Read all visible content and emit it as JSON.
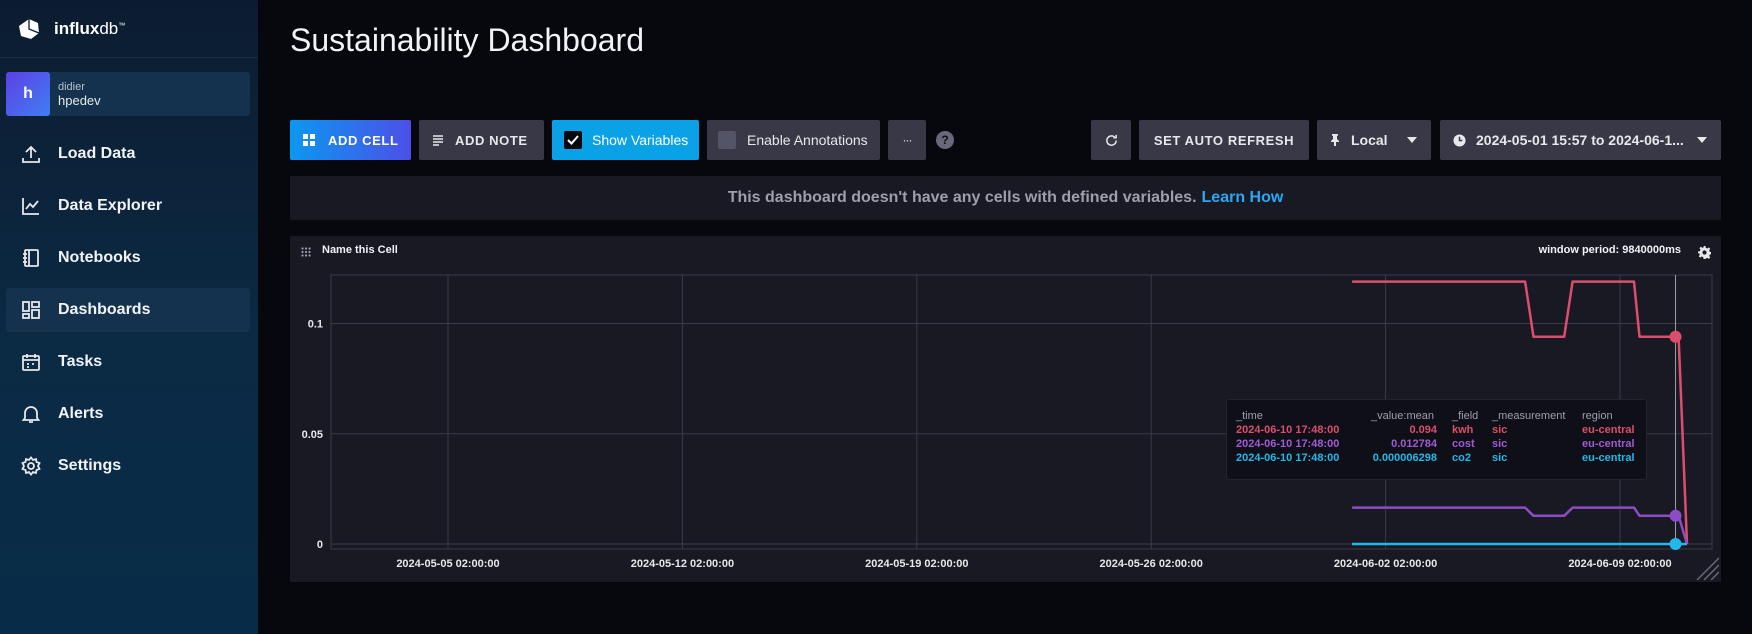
{
  "brand": {
    "name_bold": "influx",
    "name_light": "db"
  },
  "org": {
    "avatar_letter": "h",
    "user": "didier",
    "name": "hpedev"
  },
  "nav": [
    {
      "label": "Load Data",
      "icon": "upload-icon",
      "active": false
    },
    {
      "label": "Data Explorer",
      "icon": "graph-icon",
      "active": false
    },
    {
      "label": "Notebooks",
      "icon": "notebook-icon",
      "active": false
    },
    {
      "label": "Dashboards",
      "icon": "dashboard-icon",
      "active": true
    },
    {
      "label": "Tasks",
      "icon": "calendar-icon",
      "active": false
    },
    {
      "label": "Alerts",
      "icon": "bell-icon",
      "active": false
    },
    {
      "label": "Settings",
      "icon": "gear-icon",
      "active": false
    }
  ],
  "page": {
    "title": "Sustainability Dashboard"
  },
  "toolbar": {
    "add_cell": "ADD CELL",
    "add_note": "ADD NOTE",
    "show_variables": "Show Variables",
    "show_variables_checked": true,
    "enable_annotations": "Enable Annotations",
    "enable_annotations_checked": false,
    "more": "···",
    "help": "?",
    "set_auto_refresh": "SET AUTO REFRESH",
    "timezone": "Local",
    "time_range": "2024-05-01 15:57 to 2024-06-1..."
  },
  "banner": {
    "text": "This dashboard doesn't have any cells with defined variables.",
    "link": "Learn How"
  },
  "cell": {
    "name": "Name this Cell",
    "window_period": "window period: 9840000ms"
  },
  "colors": {
    "kwh": "#dc4e6d",
    "cost": "#8d4cc3",
    "co2": "#22b8ea",
    "accent": "#0b98ef"
  },
  "chart_data": {
    "type": "line",
    "y_ticks": [
      "0.1",
      "0.05",
      "0"
    ],
    "ylim": [
      0,
      0.12
    ],
    "x_ticks": [
      "2024-05-05 02:00:00",
      "2024-05-12 02:00:00",
      "2024-05-19 02:00:00",
      "2024-05-26 02:00:00",
      "2024-06-02 02:00:00",
      "2024-06-09 02:00:00"
    ],
    "grid": true,
    "series": [
      {
        "name": "kwh",
        "color": "#dc4e6d",
        "points": [
          [
            "2024-06-01 02:00",
            0.119
          ],
          [
            "2024-06-06 06:00",
            0.119
          ],
          [
            "2024-06-06 12:00",
            0.094
          ],
          [
            "2024-06-07 10:00",
            0.094
          ],
          [
            "2024-06-07 16:00",
            0.119
          ],
          [
            "2024-06-09 12:00",
            0.119
          ],
          [
            "2024-06-09 16:00",
            0.094
          ],
          [
            "2024-06-10 20:00",
            0.094
          ],
          [
            "2024-06-11 02:00",
            0.0
          ]
        ]
      },
      {
        "name": "cost",
        "color": "#8d4cc3",
        "points": [
          [
            "2024-06-01 02:00",
            0.0165
          ],
          [
            "2024-06-06 06:00",
            0.0165
          ],
          [
            "2024-06-06 12:00",
            0.0128
          ],
          [
            "2024-06-07 10:00",
            0.0128
          ],
          [
            "2024-06-07 16:00",
            0.0165
          ],
          [
            "2024-06-09 12:00",
            0.0165
          ],
          [
            "2024-06-09 16:00",
            0.0128
          ],
          [
            "2024-06-10 20:00",
            0.0128
          ],
          [
            "2024-06-11 02:00",
            0.0
          ]
        ]
      },
      {
        "name": "co2",
        "color": "#22b8ea",
        "points": [
          [
            "2024-06-01 02:00",
            6.298e-06
          ],
          [
            "2024-06-11 02:00",
            6.298e-06
          ]
        ]
      }
    ],
    "hover_time": "2024-06-10 17:48",
    "tooltip": {
      "headers": [
        "_time",
        "_value:mean",
        "_field",
        "_measurement",
        "region"
      ],
      "rows": [
        {
          "time": "2024-06-10 17:48:00",
          "value": "0.094",
          "field": "kwh",
          "measurement": "sic",
          "region": "eu-central"
        },
        {
          "time": "2024-06-10 17:48:00",
          "value": "0.012784",
          "field": "cost",
          "measurement": "sic",
          "region": "eu-central"
        },
        {
          "time": "2024-06-10 17:48:00",
          "value": "0.000006298",
          "field": "co2",
          "measurement": "sic",
          "region": "eu-central"
        }
      ]
    }
  }
}
